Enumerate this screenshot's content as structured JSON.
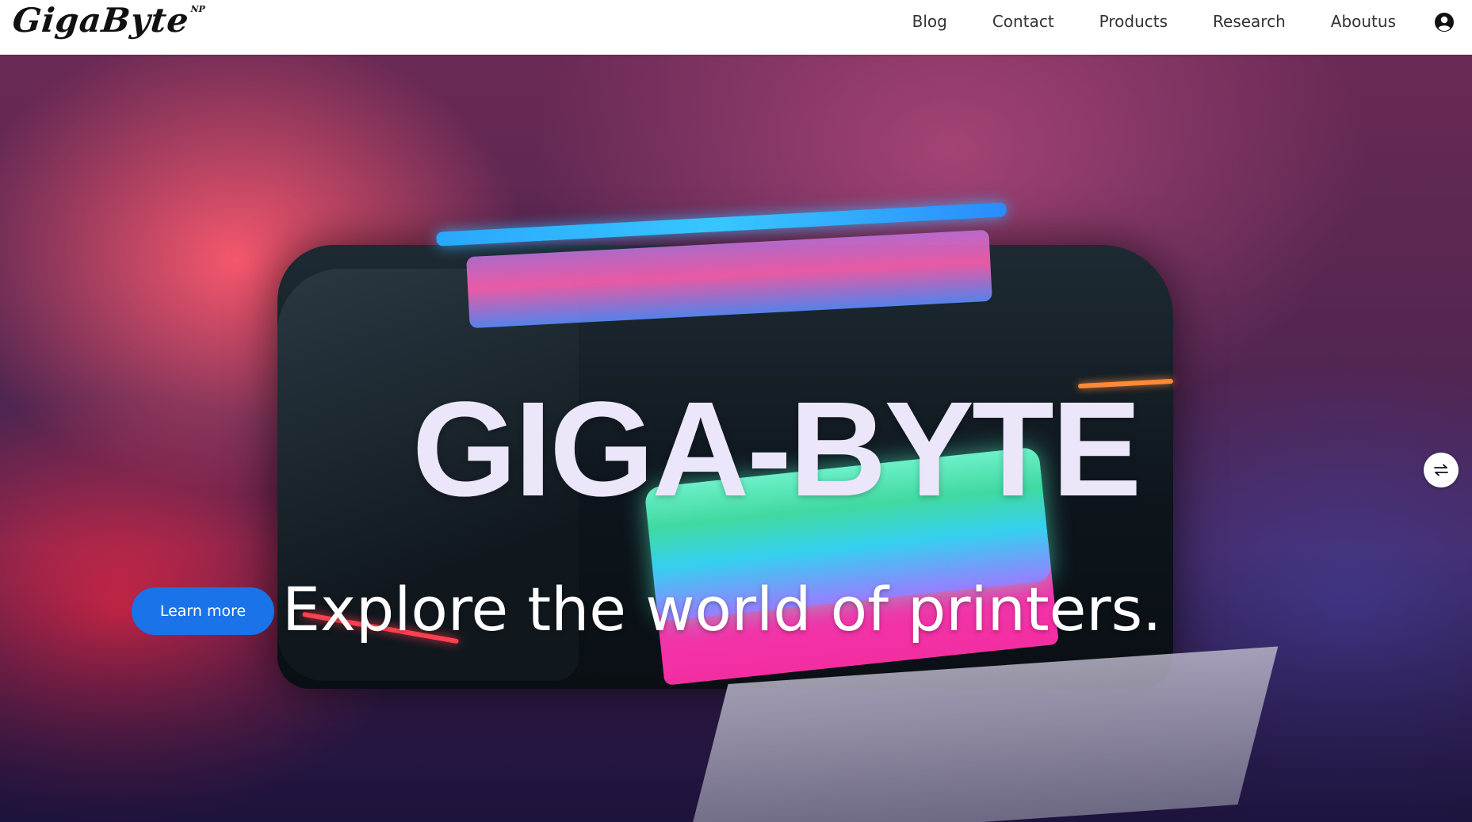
{
  "brand": {
    "name": "GigaByte",
    "superscript": "NP"
  },
  "nav": {
    "links": [
      "Blog",
      "Contact",
      "Products",
      "Research",
      "Aboutus"
    ],
    "account_icon": "user-circle-icon"
  },
  "hero": {
    "title": "GIGA-BYTE",
    "subtitle": "Explore the world of printers.",
    "cta_label": "Learn more",
    "side_control_icon": "swap-arrows-icon"
  },
  "colors": {
    "accent": "#1a73e8",
    "title_text": "#ece6fb",
    "navbar_bg": "#ffffff"
  }
}
